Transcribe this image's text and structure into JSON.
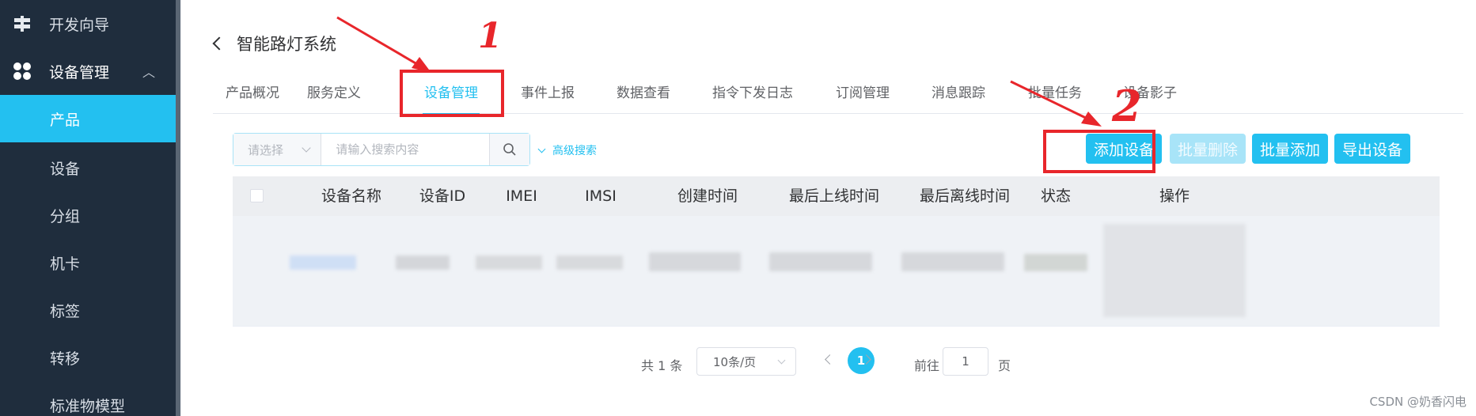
{
  "sidebar": {
    "top_item": {
      "label": "开发向导",
      "icon": "signpost-icon"
    },
    "parent": {
      "label": "设备管理",
      "icon": "grid-icon"
    },
    "items": [
      {
        "label": "产品",
        "active": true
      },
      {
        "label": "设备"
      },
      {
        "label": "分组"
      },
      {
        "label": "机卡"
      },
      {
        "label": "标签"
      },
      {
        "label": "转移"
      },
      {
        "label": "标准物模型"
      }
    ]
  },
  "header": {
    "title": "智能路灯系统"
  },
  "tabs": [
    {
      "label": "产品概况"
    },
    {
      "label": "服务定义"
    },
    {
      "label": "设备管理",
      "active": true
    },
    {
      "label": "事件上报"
    },
    {
      "label": "数据查看"
    },
    {
      "label": "指令下发日志"
    },
    {
      "label": "订阅管理"
    },
    {
      "label": "消息跟踪"
    },
    {
      "label": "批量任务"
    },
    {
      "label": "设备影子"
    }
  ],
  "search": {
    "select_placeholder": "请选择",
    "input_placeholder": "请输入搜索内容",
    "advanced_label": "高级搜索"
  },
  "actions": {
    "add_device": "添加设备",
    "batch_delete": "批量删除",
    "batch_add": "批量添加",
    "export_device": "导出设备"
  },
  "table": {
    "columns": [
      "设备名称",
      "设备ID",
      "IMEI",
      "IMSI",
      "创建时间",
      "最后上线时间",
      "最后离线时间",
      "状态",
      "操作"
    ]
  },
  "pagination": {
    "total": "共 1 条",
    "page_size": "10条/页",
    "current_page": "1",
    "goto_label": "前往",
    "goto_value": "1",
    "page_unit": "页"
  },
  "annotations": {
    "mark_1": "1",
    "mark_2": "2"
  },
  "watermark": "CSDN @奶香闪电",
  "colors": {
    "accent": "#23c0f0",
    "sidebar_bg": "#1f2d3d",
    "annotation": "#e8262b"
  }
}
